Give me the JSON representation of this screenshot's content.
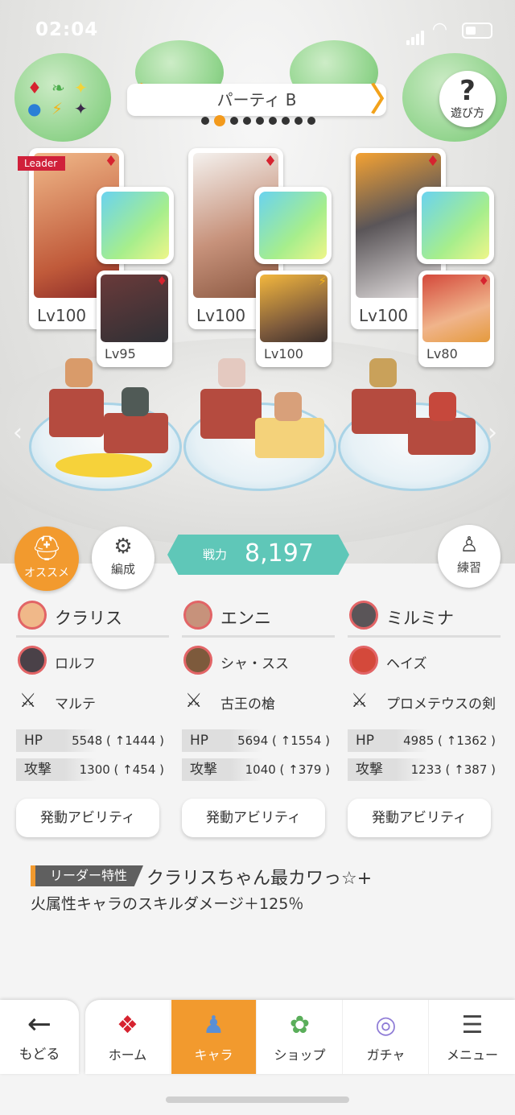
{
  "status": {
    "time": "02:04"
  },
  "party": {
    "title": "パーティ B",
    "page_count": 9,
    "active_page": 2
  },
  "help": {
    "label": "遊び方",
    "icon": "question-icon"
  },
  "leader_badge": "Leader",
  "cards": [
    {
      "level": "Lv100",
      "suit": "♦",
      "sub_level": "Lv95",
      "sub_suit": "♦"
    },
    {
      "level": "Lv100",
      "suit": "♦",
      "sub_level": "Lv100",
      "sub_suit": "⚡"
    },
    {
      "level": "Lv100",
      "suit": "♦",
      "sub_level": "Lv80",
      "sub_suit": "♦"
    }
  ],
  "buttons": {
    "recommend": "オススメ",
    "formation": "編成",
    "practice": "練習"
  },
  "power": {
    "label": "戦力",
    "value": "8,197"
  },
  "members": [
    {
      "name": "クラリス",
      "sub": "ロルフ",
      "weapon": "マルテ",
      "hp_label": "HP",
      "hp": "5548 ( ↑1444 )",
      "atk_label": "攻撃",
      "atk": "1300 ( ↑454 )",
      "ability": "発動アビリティ"
    },
    {
      "name": "エンニ",
      "sub": "シャ・スス",
      "weapon": "古王の槍",
      "hp_label": "HP",
      "hp": "5694 ( ↑1554 )",
      "atk_label": "攻撃",
      "atk": "1040 ( ↑379 )",
      "ability": "発動アビリティ"
    },
    {
      "name": "ミルミナ",
      "sub": "ヘイズ",
      "weapon": "プロメテウスの剣",
      "hp_label": "HP",
      "hp": "4985 ( ↑1362 )",
      "atk_label": "攻撃",
      "atk": "1233 ( ↑387 )",
      "ability": "発動アビリティ"
    }
  ],
  "leader_trait": {
    "tag": "リーダー特性",
    "name": "クラリスちゃん最カワっ☆+",
    "desc": "火属性キャラのスキルダメージ＋125％"
  },
  "nav": {
    "back": "もどる",
    "tabs": [
      "ホーム",
      "キャラ",
      "ショップ",
      "ガチャ",
      "メニュー"
    ],
    "active": "キャラ"
  },
  "colors": {
    "accent": "#f29a2e",
    "power": "#5fc7b8",
    "fire": "#d6232f"
  }
}
